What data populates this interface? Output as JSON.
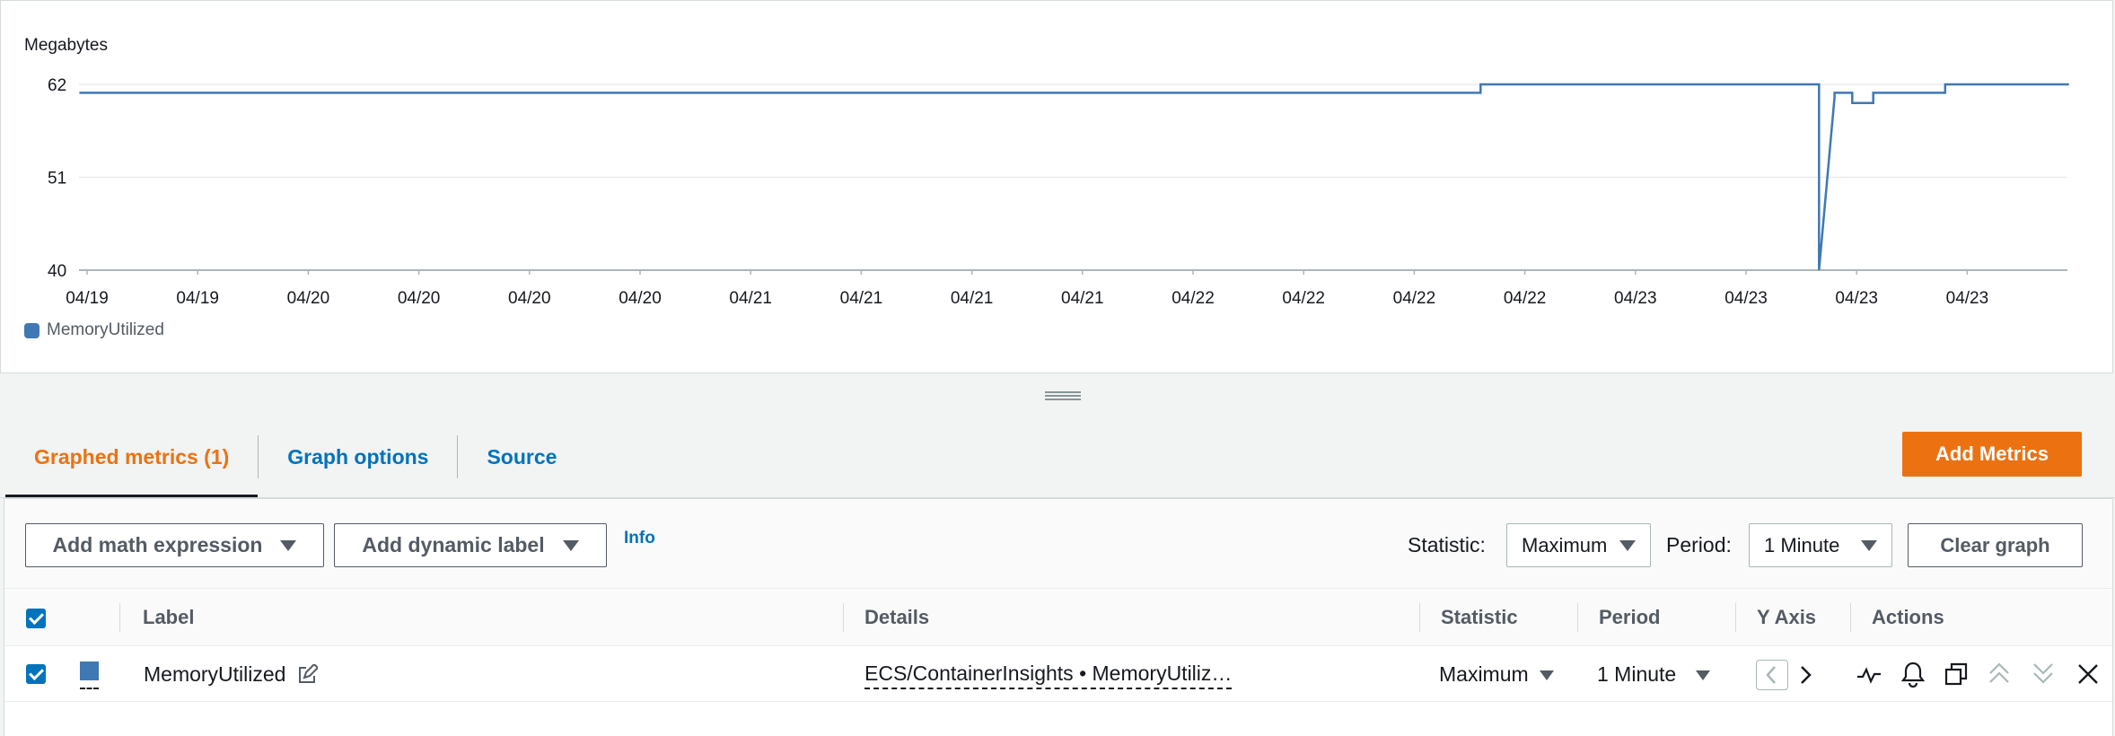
{
  "chart": {
    "unit_label": "Megabytes",
    "legend_label": "MemoryUtilized",
    "series_color": "#3f78b3"
  },
  "chart_data": {
    "type": "line",
    "ylabel": "Megabytes",
    "ylim": [
      40,
      62
    ],
    "yticks": [
      62,
      51,
      40
    ],
    "x_tick_labels": [
      "04/19",
      "04/19",
      "04/20",
      "04/20",
      "04/20",
      "04/20",
      "04/21",
      "04/21",
      "04/21",
      "04/21",
      "04/22",
      "04/22",
      "04/22",
      "04/22",
      "04/23",
      "04/23",
      "04/23",
      "04/23"
    ],
    "series": [
      {
        "name": "MemoryUtilized",
        "x_positions_in_ticks": [
          -0.07,
          12.6,
          12.6,
          15.66,
          15.66,
          15.8,
          15.8,
          15.96,
          15.96,
          16.15,
          16.15,
          16.8,
          16.8,
          17.92
        ],
        "values": [
          61.0,
          61.0,
          62.0,
          62.0,
          40.0,
          60.5,
          61.0,
          61.0,
          59.8,
          59.8,
          61.0,
          61.0,
          62.0,
          62.0
        ]
      }
    ]
  },
  "tabs": [
    {
      "label": "Graphed metrics (1)",
      "active": true
    },
    {
      "label": "Graph options",
      "active": false
    },
    {
      "label": "Source",
      "active": false
    }
  ],
  "add_metrics_label": "Add Metrics",
  "toolbar": {
    "math_label": "Add math expression",
    "dynamic_label": "Add dynamic label",
    "info_label": "Info",
    "statistic_label": "Statistic:",
    "statistic_value": "Maximum",
    "period_label": "Period:",
    "period_value": "1 Minute",
    "clear_label": "Clear graph"
  },
  "table": {
    "headers": {
      "label": "Label",
      "details": "Details",
      "statistic": "Statistic",
      "period": "Period",
      "yaxis": "Y Axis",
      "actions": "Actions"
    },
    "rows": [
      {
        "label": "MemoryUtilized",
        "details": "ECS/ContainerInsights • MemoryUtiliz…",
        "statistic": "Maximum",
        "period": "1 Minute",
        "color": "#3f78b3"
      }
    ]
  }
}
